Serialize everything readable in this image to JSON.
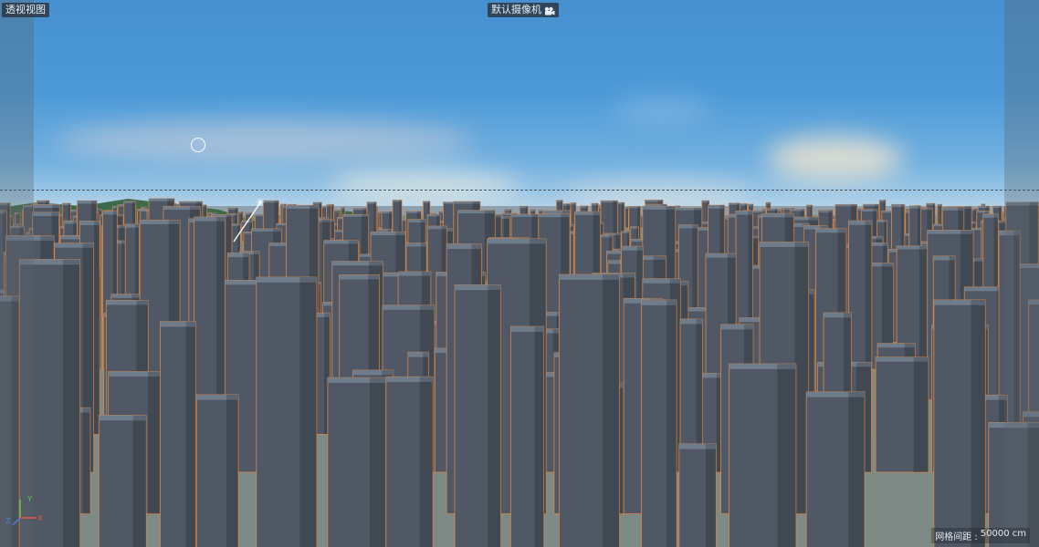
{
  "viewport": {
    "view_name": "透视视图",
    "camera_name": "默认摄像机",
    "camera_icon": "camera-icon",
    "grid_spacing_label": "网格间距 :",
    "grid_spacing_value": "50000 cm"
  },
  "axes": {
    "x_label": "X",
    "y_label": "Y",
    "z_label": "Z",
    "x_color": "#e05a4a",
    "y_color": "#6cc24a",
    "z_color": "#4a7ee0"
  },
  "colors": {
    "sky_top": "#4690cf",
    "sky_horizon": "#b9d6ea",
    "building": "#4f5864",
    "building_roof": "#6f7c8c",
    "building_outline": "#d8884a",
    "mountain": "#3e6a4a",
    "ground": "#7e8a86"
  }
}
